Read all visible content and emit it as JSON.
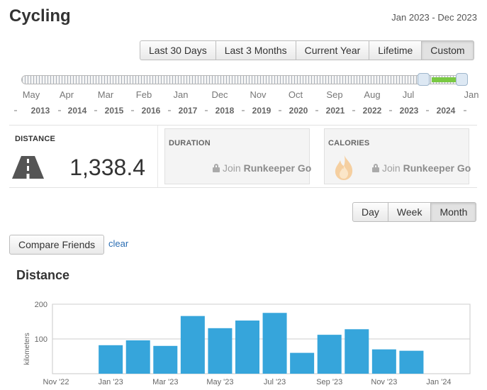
{
  "header": {
    "title": "Cycling",
    "date_range": "Jan 2023 - Dec 2023"
  },
  "range_buttons": [
    {
      "label": "Last 30 Days",
      "active": false
    },
    {
      "label": "Last 3 Months",
      "active": false
    },
    {
      "label": "Current Year",
      "active": false
    },
    {
      "label": "Lifetime",
      "active": false
    },
    {
      "label": "Custom",
      "active": true
    }
  ],
  "timeline": {
    "months": [
      "May",
      "Apr",
      "Mar",
      "Feb",
      "Jan",
      "Dec",
      "Nov",
      "Oct",
      "Sep",
      "Aug",
      "Jul",
      "Jan"
    ],
    "years": [
      "2013",
      "2014",
      "2015",
      "2016",
      "2017",
      "2018",
      "2019",
      "2020",
      "2021",
      "2022",
      "2023",
      "2024"
    ]
  },
  "stats": {
    "distance": {
      "label": "DISTANCE",
      "value": "1,338.4",
      "icon": "road-icon"
    },
    "duration": {
      "label": "DURATION",
      "join_prefix": "Join ",
      "join_brand": "Runkeeper Go",
      "icon": "lock-icon"
    },
    "calories": {
      "label": "CALORIES",
      "join_prefix": "Join ",
      "join_brand": "Runkeeper Go",
      "icon": "flame-icon"
    }
  },
  "period_buttons": [
    {
      "label": "Day",
      "active": false
    },
    {
      "label": "Week",
      "active": false
    },
    {
      "label": "Month",
      "active": true
    }
  ],
  "compare": {
    "button_label": "Compare Friends",
    "clear_label": "clear"
  },
  "section_title": "Distance",
  "colors": {
    "bar": "#36a5db",
    "slider_fill": "#7ac943",
    "link": "#2a6db3"
  },
  "chart_data": {
    "type": "bar",
    "title": "",
    "xlabel": "",
    "ylabel": "kilometers",
    "ylim": [
      0,
      200
    ],
    "yticks": [
      100,
      200
    ],
    "x_tick_labels": [
      "Nov '22",
      "Jan '23",
      "Mar '23",
      "May '23",
      "Jul '23",
      "Sep '23",
      "Nov '23",
      "Jan '24"
    ],
    "categories": [
      "Nov '22",
      "Dec '22",
      "Jan '23",
      "Feb '23",
      "Mar '23",
      "Apr '23",
      "May '23",
      "Jun '23",
      "Jul '23",
      "Aug '23",
      "Sep '23",
      "Oct '23",
      "Nov '23",
      "Dec '23",
      "Jan '24"
    ],
    "values": [
      0,
      0,
      82,
      96,
      80,
      166,
      131,
      153,
      175,
      60,
      112,
      128,
      70,
      66,
      0
    ],
    "grid": true
  }
}
